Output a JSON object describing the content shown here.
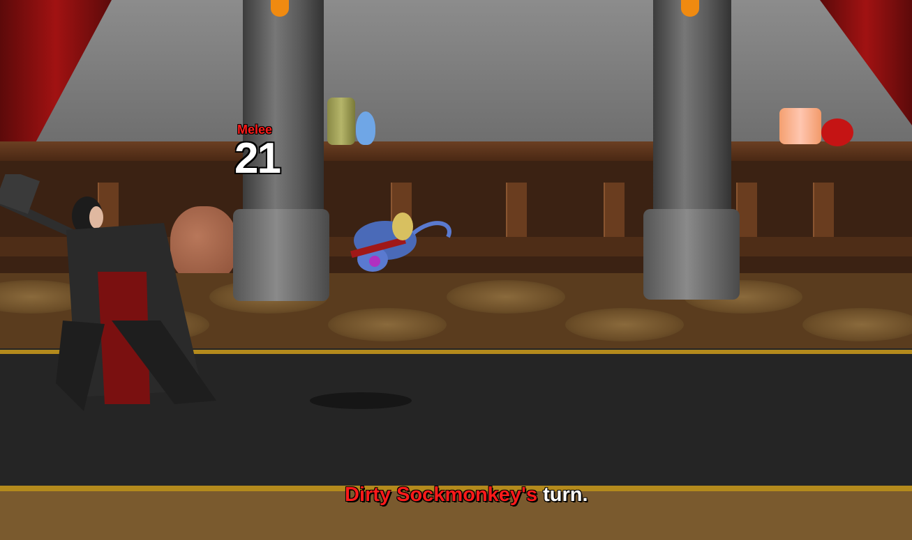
{
  "combat_popup": {
    "attack_type": "Melee",
    "damage": "21"
  },
  "turn_indicator": {
    "name": "Dirty Sockmonkey's",
    "suffix": " turn."
  },
  "colors": {
    "damage_type": "#ff1a1a",
    "damage_number": "#ffffff",
    "turn_name": "#ff1a1a"
  },
  "icons": {
    "player": "armored-warrior-sprite",
    "enemy": "sockmonkey-sprite"
  }
}
